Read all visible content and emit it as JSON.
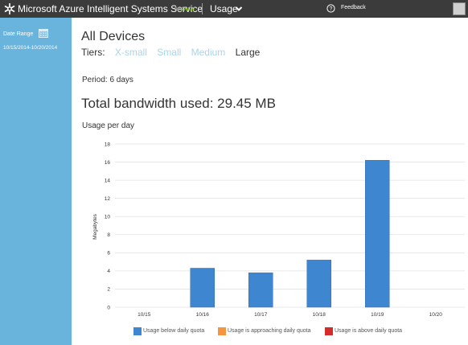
{
  "header": {
    "title": "Microsoft Azure Intelligent Systems Service",
    "badge": "PREVIEW",
    "menu": "Usage",
    "feedback": "Feedback"
  },
  "sidebar": {
    "date_range_label": "Date Range",
    "date_range_value": "10/15/2014-10/20/2014"
  },
  "main": {
    "title": "All Devices",
    "tiers_label": "Tiers:",
    "tiers": [
      "X-small",
      "Small",
      "Medium",
      "Large"
    ],
    "active_tier": "Large",
    "period": "Period: 6 days",
    "total": "Total bandwidth used: 29.45 MB",
    "usage_title": "Usage per day"
  },
  "colors": {
    "below": "#3f86d0",
    "approaching": "#f5953f",
    "above": "#d42b2b",
    "sidebar": "#68b4dc"
  },
  "chart_data": {
    "type": "bar",
    "categories": [
      "10/15",
      "10/16",
      "10/17",
      "10/18",
      "10/19",
      "10/20"
    ],
    "values": [
      0,
      4.3,
      3.8,
      5.2,
      16.2,
      0
    ],
    "ylabel": "Megabytes",
    "ylim": [
      0,
      18
    ],
    "yticks": [
      0,
      2,
      4,
      6,
      8,
      10,
      12,
      14,
      16,
      18
    ],
    "grid": true,
    "legend": [
      {
        "label": "Usage below daily quota",
        "color": "#3f86d0"
      },
      {
        "label": "Usage is approaching daily quota",
        "color": "#f5953f"
      },
      {
        "label": "Usage is above daily quota",
        "color": "#d42b2b"
      }
    ],
    "legend_position": "bottom"
  }
}
